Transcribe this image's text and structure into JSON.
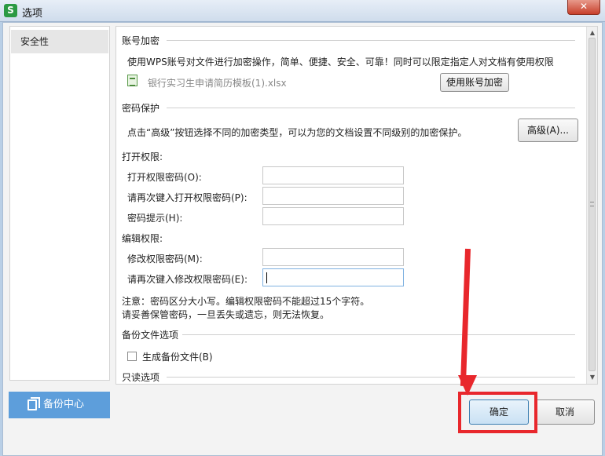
{
  "window": {
    "app_icon_letter": "S",
    "title": "选项",
    "close_glyph": "✕"
  },
  "sidebar": {
    "items": [
      {
        "label": "安全性"
      }
    ]
  },
  "backup_center": {
    "label": "备份中心"
  },
  "account_encryption": {
    "heading": "账号加密",
    "description": "使用WPS账号对文件进行加密操作，简单、便捷、安全、可靠！同时可以限定指定人对文档有使用权限",
    "filename": "银行实习生申请简历模板(1).xlsx",
    "button": "使用账号加密"
  },
  "password_protection": {
    "heading": "密码保护",
    "description": "点击“高级”按钮选择不同的加密类型，可以为您的文档设置不同级别的加密保护。",
    "advanced_button": "高级(A)..."
  },
  "open_permission": {
    "heading": "打开权限:",
    "fields": [
      {
        "label": "打开权限密码(O):",
        "value": ""
      },
      {
        "label": "请再次键入打开权限密码(P):",
        "value": ""
      },
      {
        "label": "密码提示(H):",
        "value": ""
      }
    ]
  },
  "edit_permission": {
    "heading": "编辑权限:",
    "fields": [
      {
        "label": "修改权限密码(M):",
        "value": ""
      },
      {
        "label": "请再次键入修改权限密码(E):",
        "value": ""
      }
    ]
  },
  "notes": [
    "注意：密码区分大小写。编辑权限密码不能超过15个字符。",
    "请妥善保管密码，一旦丢失或遗忘，则无法恢复。"
  ],
  "backup_options": {
    "heading": "备份文件选项",
    "checkbox_label": "生成备份文件(B)",
    "checked": false
  },
  "readonly_options": {
    "heading": "只读选项"
  },
  "footer": {
    "ok": "确定",
    "cancel": "取消"
  },
  "colors": {
    "accent": "#5d9edb",
    "annotation_red": "#e8272c"
  }
}
